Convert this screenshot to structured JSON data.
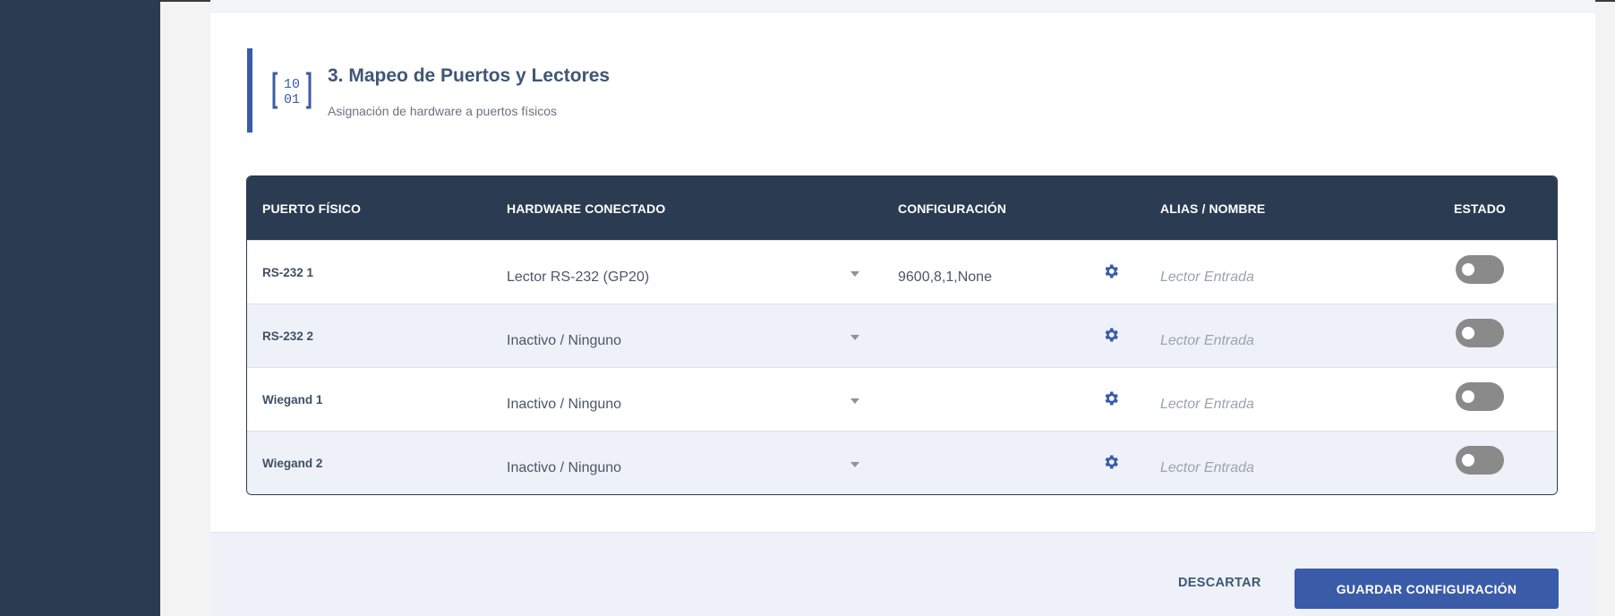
{
  "section": {
    "title": "3. Mapeo de Puertos y Lectores",
    "subtitle": "Asignación de hardware a puertos físicos",
    "icon": "binary-icon",
    "accent_color": "#3a5ba8"
  },
  "table": {
    "headers": {
      "port": "PUERTO FÍSICO",
      "hardware": "HARDWARE CONECTADO",
      "config": "CONFIGURACIÓN",
      "alias": "ALIAS / NOMBRE",
      "status": "ESTADO"
    },
    "rows": [
      {
        "port": "RS-232 1",
        "hardware": "Lector RS-232 (GP20)",
        "config": "9600,8,1,None",
        "alias_placeholder": "Lector Entrada",
        "enabled": false
      },
      {
        "port": "RS-232 2",
        "hardware": "Inactivo / Ninguno",
        "config": "",
        "alias_placeholder": "Lector Entrada",
        "enabled": false
      },
      {
        "port": "Wiegand 1",
        "hardware": "Inactivo / Ninguno",
        "config": "",
        "alias_placeholder": "Lector Entrada",
        "enabled": false
      },
      {
        "port": "Wiegand 2",
        "hardware": "Inactivo / Ninguno",
        "config": "",
        "alias_placeholder": "Lector Entrada",
        "enabled": false
      }
    ]
  },
  "footer": {
    "discard_label": "DESCARTAR",
    "save_label": "GUARDAR CONFIGURACIÓN"
  },
  "colors": {
    "sidebar": "#2b3b52",
    "header_bg": "#2b3b52",
    "primary": "#3a5ba8",
    "toggle_off": "#8a8a8a"
  }
}
